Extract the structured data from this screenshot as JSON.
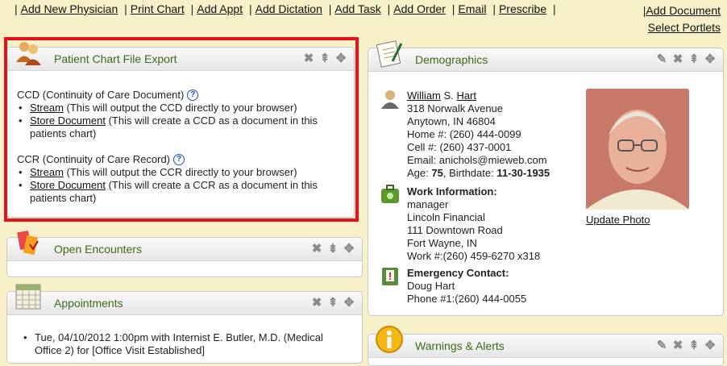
{
  "toplinks": {
    "items": [
      "Add New Physician",
      "Print Chart",
      "Add Appt",
      "Add Dictation",
      "Add Task",
      "Add Order",
      "Email",
      "Prescribe"
    ],
    "right_items": [
      "Add Document",
      "Select Portlets"
    ]
  },
  "export": {
    "title": "Patient Chart File Export",
    "ccd_heading": "CCD (Continuity of Care Document)",
    "ccd_stream_link": "Stream",
    "ccd_stream_desc": "(This will output the CCD directly to your browser)",
    "ccd_store_link": "Store Document",
    "ccd_store_desc": "(This will create a CCD as a document in this patients chart)",
    "ccr_heading": "CCR (Continuity of Care Record)",
    "ccr_stream_link": "Stream",
    "ccr_stream_desc": "(This will output the CCR directly to your browser)",
    "ccr_store_link": "Store Document",
    "ccr_store_desc": "(This will create a CCR as a document in this patients chart)",
    "help_glyph": "?"
  },
  "encounters": {
    "title": "Open Encounters"
  },
  "appointments": {
    "title": "Appointments",
    "item": "Tue, 04/10/2012 1:00pm with Internist E. Butler, M.D. (Medical Office 2) for [Office Visit Established]"
  },
  "demographics": {
    "title": "Demographics",
    "first_name": "William",
    "middle": "S.",
    "last_name": "Hart",
    "address1": "318 Norwalk Avenue",
    "address2": "Anytown, IN 46804",
    "home_phone": "Home #: (260) 444-0099",
    "cell_phone": "Cell #: (260) 437-0001",
    "email": "Email: anichols@mieweb.com",
    "age_label": "Age:",
    "age": "75",
    "birthdate_label": "Birthdate:",
    "birthdate": "11-30-1935",
    "work_heading": "Work Information:",
    "work_title": "manager",
    "work_company": "Lincoln Financial",
    "work_address1": "111 Downtown Road",
    "work_address2": "Fort Wayne, IN",
    "work_phone": "Work #:(260) 459-6270 x318",
    "emergency_heading": "Emergency Contact:",
    "emergency_name": "Doug Hart",
    "emergency_phone": "Phone #1:(260) 444-0055",
    "update_photo": "Update Photo"
  },
  "warnings": {
    "title": "Warnings & Alerts"
  },
  "colors": {
    "title_green": "#3d6a1a",
    "page_bg": "#f8f0c8",
    "highlight_red": "#e8111b"
  }
}
